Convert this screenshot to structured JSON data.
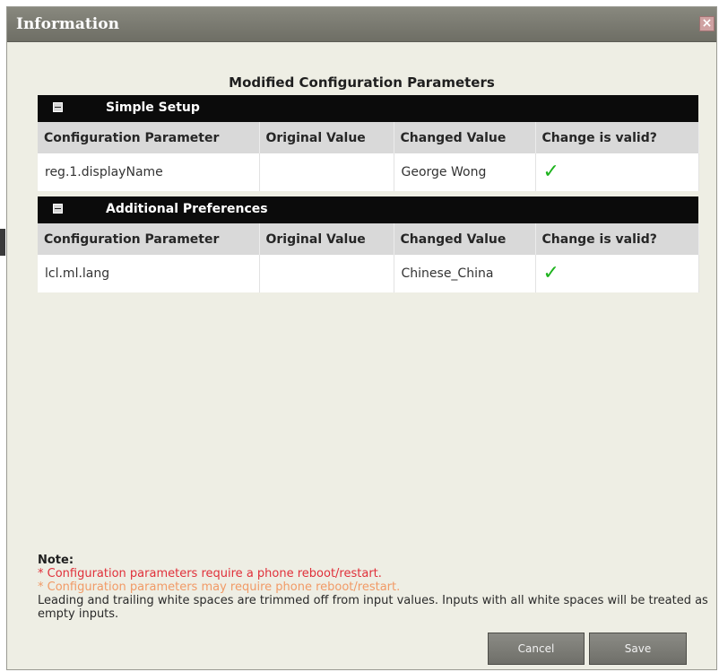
{
  "dialog": {
    "title": "Information",
    "close_symbol": "×"
  },
  "heading": "Modified Configuration Parameters",
  "columns": {
    "param": "Configuration Parameter",
    "original": "Original Value",
    "changed": "Changed Value",
    "valid": "Change is valid?"
  },
  "sections": [
    {
      "title": "Simple Setup",
      "rows": [
        {
          "param": "reg.1.displayName",
          "original": "",
          "changed": "George Wong",
          "valid_icon": "checkmark-icon",
          "valid_symbol": "✓"
        }
      ]
    },
    {
      "title": "Additional Preferences",
      "rows": [
        {
          "param": "lcl.ml.lang",
          "original": "",
          "changed": "Chinese_China",
          "valid_icon": "checkmark-icon",
          "valid_symbol": "✓"
        }
      ]
    }
  ],
  "note": {
    "title": "Note:",
    "line_red": "* Configuration parameters require a phone reboot/restart.",
    "line_orange": "* Configuration parameters may require phone reboot/restart.",
    "line_plain": "Leading and trailing white spaces are trimmed off from input values. Inputs with all white spaces will be treated as empty inputs."
  },
  "buttons": {
    "cancel": "Cancel",
    "save": "Save"
  },
  "colors": {
    "valid_check": "#1db31d",
    "note_red": "#e0303a",
    "note_orange": "#f19a66",
    "section_header": "#0b0b0b"
  }
}
